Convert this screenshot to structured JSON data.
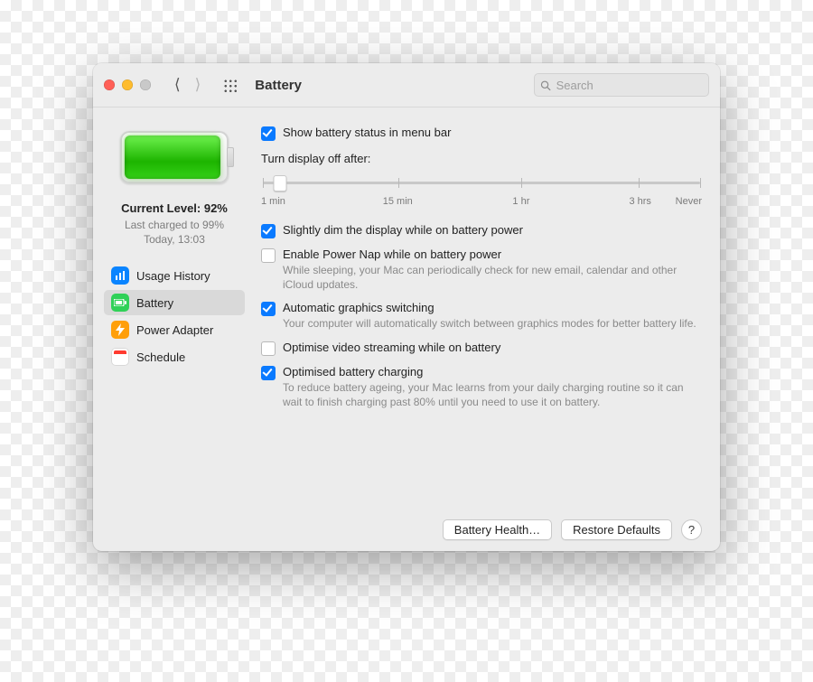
{
  "header": {
    "title": "Battery",
    "search_placeholder": "Search"
  },
  "sidebar": {
    "level_label": "Current Level: 92%",
    "last_charged": "Last charged to 99%",
    "last_charged_time": "Today, 13:03",
    "items": [
      {
        "label": "Usage History"
      },
      {
        "label": "Battery"
      },
      {
        "label": "Power Adapter"
      },
      {
        "label": "Schedule"
      }
    ]
  },
  "settings": {
    "show_status_label": "Show battery status in menu bar",
    "show_status_checked": true,
    "display_off_label": "Turn display off after:",
    "display_off_ticks": [
      "1 min",
      "15 min",
      "1 hr",
      "3 hrs",
      "Never"
    ],
    "display_off_tick_positions_pct": [
      0,
      31,
      59,
      86,
      100
    ],
    "display_off_value_pct": 4,
    "dim_label": "Slightly dim the display while on battery power",
    "dim_checked": true,
    "powernap_label": "Enable Power Nap while on battery power",
    "powernap_desc": "While sleeping, your Mac can periodically check for new email, calendar and other iCloud updates.",
    "powernap_checked": false,
    "gpu_label": "Automatic graphics switching",
    "gpu_desc": "Your computer will automatically switch between graphics modes for better battery life.",
    "gpu_checked": true,
    "video_label": "Optimise video streaming while on battery",
    "video_checked": false,
    "optcharge_label": "Optimised battery charging",
    "optcharge_desc": "To reduce battery ageing, your Mac learns from your daily charging routine so it can wait to finish charging past 80% until you need to use it on battery.",
    "optcharge_checked": true
  },
  "footer": {
    "battery_health": "Battery Health…",
    "restore": "Restore Defaults",
    "help": "?"
  }
}
